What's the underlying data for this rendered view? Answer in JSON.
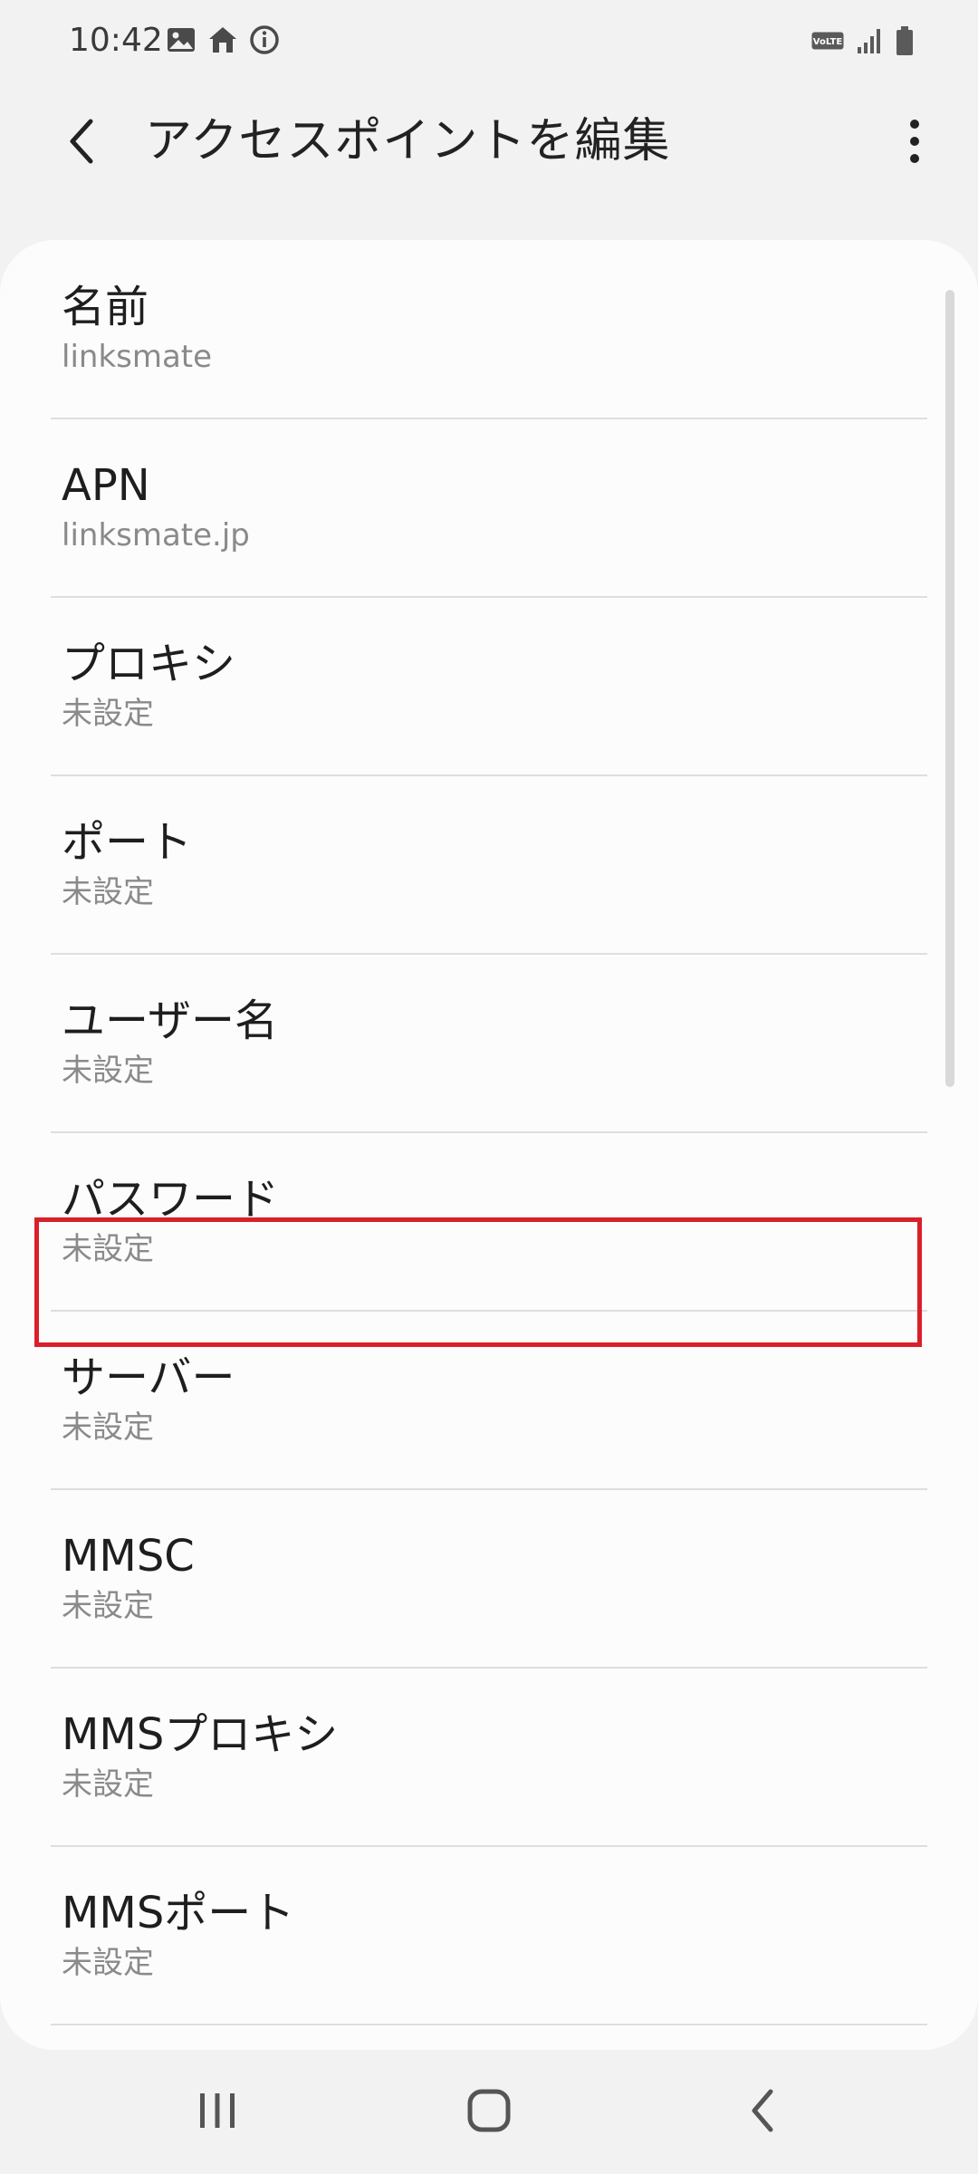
{
  "status_bar": {
    "time": "10:42",
    "left_icons": [
      "image-icon",
      "home-icon",
      "info-icon"
    ],
    "right_icons": [
      "volte-icon",
      "signal-icon",
      "battery-icon"
    ],
    "volte_label": "VoLTE"
  },
  "app_bar": {
    "title": "アクセスポイントを編集",
    "back_icon": "back-arrow-icon",
    "more_icon": "more-vert-icon"
  },
  "settings": {
    "items": [
      {
        "title": "名前",
        "value": "linksmate"
      },
      {
        "title": "APN",
        "value": "linksmate.jp"
      },
      {
        "title": "プロキシ",
        "value": "未設定"
      },
      {
        "title": "ポート",
        "value": "未設定"
      },
      {
        "title": "ユーザー名",
        "value": "未設定",
        "highlighted": true
      },
      {
        "title": "パスワード",
        "value": "未設定"
      },
      {
        "title": "サーバー",
        "value": "未設定"
      },
      {
        "title": "MMSC",
        "value": "未設定"
      },
      {
        "title": "MMSプロキシ",
        "value": "未設定"
      },
      {
        "title": "MMSポート",
        "value": "未設定"
      }
    ]
  },
  "nav_bar": {
    "buttons": [
      "recents-icon",
      "home-button-icon",
      "back-icon"
    ]
  },
  "colors": {
    "highlight": "#d9202a",
    "background": "#f2f2f2",
    "card": "#fcfcfc"
  }
}
